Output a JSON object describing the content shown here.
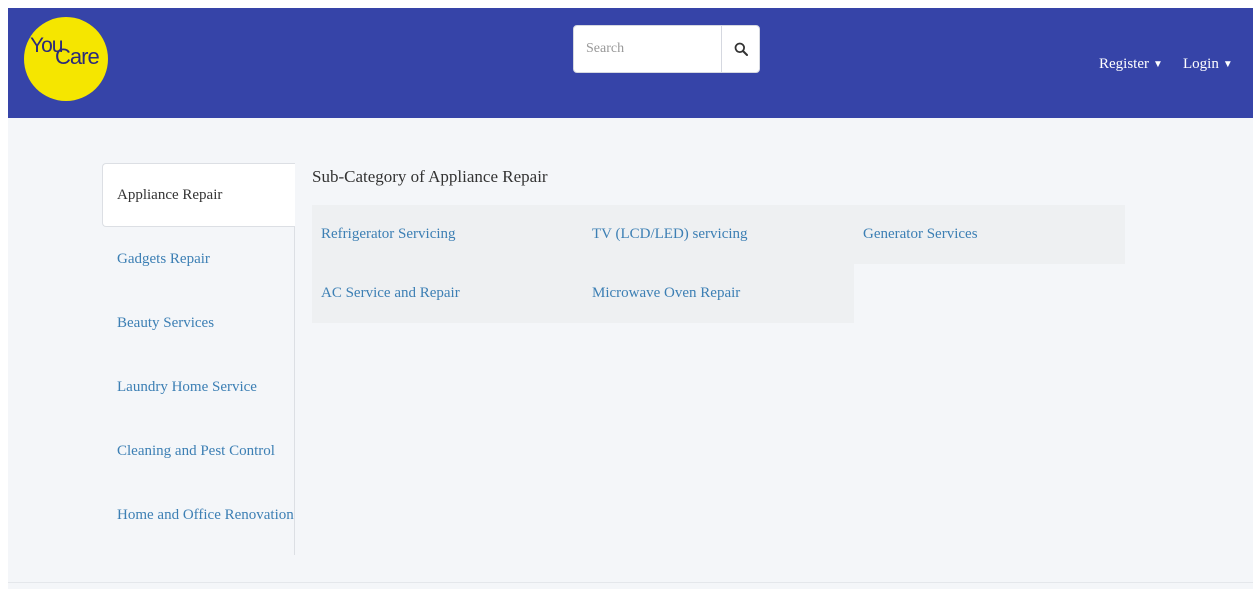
{
  "brand": {
    "logo_line1": "You",
    "logo_line2": "Care"
  },
  "search": {
    "placeholder": "Search",
    "icon": "search-icon"
  },
  "nav": {
    "register": "Register",
    "login": "Login",
    "caret_icon": "caret-down-icon"
  },
  "sidebar": {
    "items": [
      {
        "label": "Appliance Repair",
        "active": true
      },
      {
        "label": "Gadgets Repair"
      },
      {
        "label": "Beauty Services"
      },
      {
        "label": "Laundry Home Service"
      },
      {
        "label": "Cleaning and Pest Control"
      },
      {
        "label": "Home and Office Renovation"
      }
    ]
  },
  "main": {
    "heading": "Sub-Category of Appliance Repair",
    "subcategories": [
      "Refrigerator Servicing",
      "TV (LCD/LED) servicing",
      "Generator Services",
      "AC Service and Repair",
      "Microwave Oven Repair"
    ]
  },
  "colors": {
    "navbar": "#3644a8",
    "logo": "#f5e600",
    "link": "#3c7fb4",
    "page_bg": "#f4f6f9",
    "cell_bg": "#eef0f2"
  }
}
